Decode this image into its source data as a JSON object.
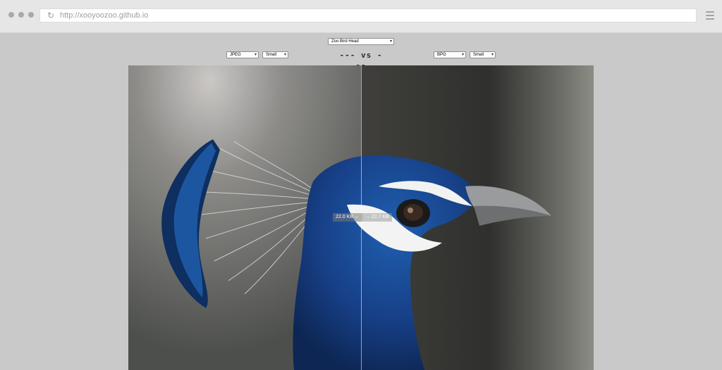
{
  "browser": {
    "url": "http://xooyoozoo.github.io",
    "icons": [
      "reload-icon",
      "menu-icon"
    ]
  },
  "controls": {
    "image_select": "Zoo Bird Head",
    "left_format": "JPEG",
    "left_size": "Small",
    "right_format": "BPG",
    "right_size": "Small",
    "vs_text": "--- vs ---"
  },
  "comparison": {
    "left_size_label": "22.0 KB ←",
    "right_size_label": "→ 22.7 KB",
    "divider_position": 0.5
  }
}
